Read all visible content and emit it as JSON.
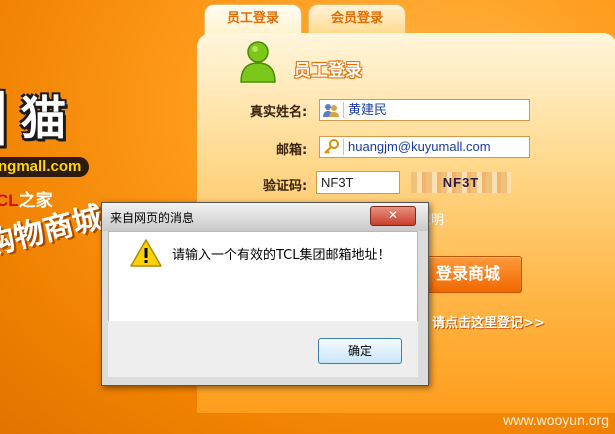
{
  "branding": {
    "title_fragment": "猫",
    "domain_fragment": "ngmall.com",
    "tcl_brand": "CL",
    "tcl_suffix": "之家",
    "slogan_fragment": "购物商城"
  },
  "tabs": [
    {
      "label": "员工登录",
      "active": true
    },
    {
      "label": "会员登录",
      "active": false
    }
  ],
  "form": {
    "heading": "员工登录",
    "name_label": "真实姓名:",
    "name_value": "黄建民",
    "email_label": "邮箱:",
    "email_value": "huangjm@kuyumall.com",
    "captcha_label": "验证码:",
    "captcha_value": "NF3T",
    "captcha_image_text": "NF3T",
    "hidden_note_fragment": "说明",
    "login_button": "登录商城",
    "register_link": "请点击这里登记>>"
  },
  "dialog": {
    "title": "来自网页的消息",
    "message": "请输入一个有效的TCL集团邮箱地址！",
    "ok_label": "确定",
    "close_icon": "close-icon"
  },
  "watermark": "www.wooyun.org",
  "colors": {
    "background": "#ff9a1a",
    "panel": "#ffd88a",
    "accent": "#e46c00",
    "login_button": "#f06800",
    "dialog_ok_border": "#3c7fb1"
  }
}
